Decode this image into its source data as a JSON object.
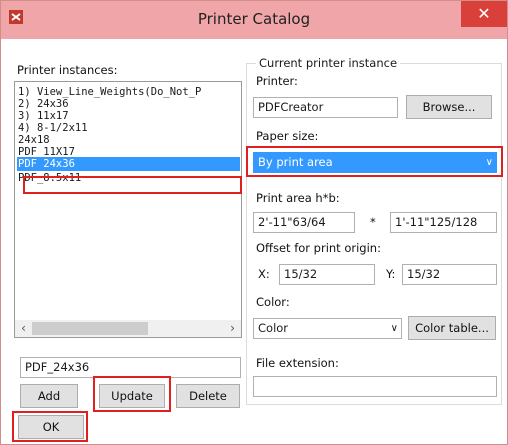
{
  "window": {
    "title": "Printer Catalog"
  },
  "instances": {
    "label": "Printer instances:",
    "items": [
      "1) View_Line_Weights(Do_Not_P",
      "2) 24x36",
      "3) 11x17",
      "4) 8-1/2x11",
      "24x18",
      "PDF 11X17",
      "PDF 24x36",
      "PDF_8.5x11"
    ],
    "selected_index": 6,
    "name_value": "PDF_24x36"
  },
  "buttons": {
    "add": "Add",
    "update": "Update",
    "delete": "Delete",
    "ok": "OK",
    "browse": "Browse...",
    "color_table": "Color table..."
  },
  "current": {
    "group_label": "Current printer instance",
    "printer_label": "Printer:",
    "printer_value": "PDFCreator",
    "paper_label": "Paper size:",
    "paper_value": "By print area",
    "area_label": "Print area h*b:",
    "area_h": "2'-11\"63/64",
    "area_sep": "*",
    "area_b": "1'-11\"125/128",
    "offset_label": "Offset for print origin:",
    "x_label": "X:",
    "x_value": "15/32",
    "y_label": "Y:",
    "y_value": "15/32",
    "color_label": "Color:",
    "color_value": "Color",
    "ext_label": "File extension:",
    "ext_value": ""
  },
  "colors": {
    "titlebar": "#f0a6a8",
    "selection": "#3399ff",
    "highlight": "#e0201e",
    "close": "#d9403a"
  },
  "icons": {
    "app": "printer-app-icon",
    "close": "close-icon",
    "dropdown": "chevron-down-icon",
    "scroll_left": "scroll-left-icon",
    "scroll_right": "scroll-right-icon"
  }
}
